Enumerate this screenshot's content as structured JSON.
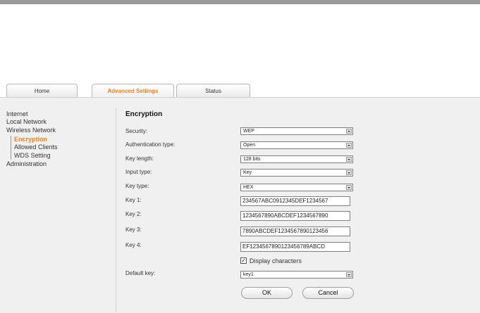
{
  "tabs": [
    {
      "label": "Home",
      "active": false
    },
    {
      "label": "Advanced Settings",
      "active": true
    },
    {
      "label": "Status",
      "active": false
    }
  ],
  "sidebar": {
    "items": [
      {
        "label": "Internet"
      },
      {
        "label": "Local Network"
      },
      {
        "label": "Wireless Network"
      },
      {
        "label": "Encryption",
        "current": true
      },
      {
        "label": "Allowed Clients"
      },
      {
        "label": "WDS Setting"
      },
      {
        "label": "Administration"
      }
    ]
  },
  "form": {
    "title": "Encryption",
    "security": {
      "label": "Security:",
      "value": "WEP"
    },
    "auth_type": {
      "label": "Authentication type:",
      "value": "Open"
    },
    "key_length": {
      "label": "Key length:",
      "value": "128 bits"
    },
    "input_type": {
      "label": "Input type:",
      "value": "Key"
    },
    "key_type": {
      "label": "Key type:",
      "value": "HEX"
    },
    "key1": {
      "label": "Key 1:",
      "value": "234567ABC0912345DEF1234567"
    },
    "key2": {
      "label": "Key 2:",
      "value": "1234567890ABCDEF1234567890"
    },
    "key3": {
      "label": "Key 3:",
      "value": "7890ABCDEF1234567890123456"
    },
    "key4": {
      "label": "Key 4:",
      "value": "EF1234567890123456789ABCD"
    },
    "display_characters": {
      "label": "Display characters",
      "checked": true
    },
    "default_key": {
      "label": "Default key:",
      "value": "key1"
    },
    "ok_label": "OK",
    "cancel_label": "Cancel"
  },
  "colors": {
    "accent": "#e8821e",
    "panel": "#f0f0f0"
  }
}
